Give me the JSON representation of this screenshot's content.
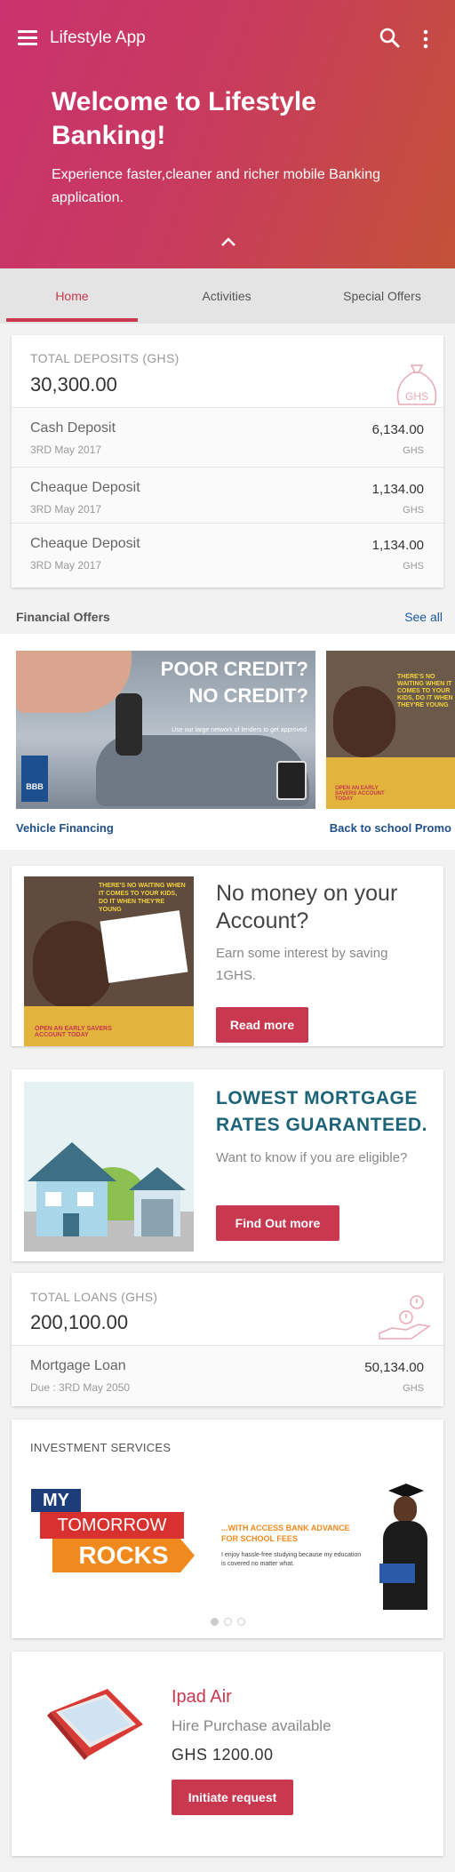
{
  "header": {
    "app_title": "Lifestyle App",
    "welcome_title": "Welcome to Lifestyle Banking!",
    "subtitle": "Experience faster,cleaner and richer mobile Banking application."
  },
  "tabs": [
    {
      "label": "Home",
      "active": true
    },
    {
      "label": "Activities",
      "active": false
    },
    {
      "label": "Special Offers",
      "active": false
    }
  ],
  "deposits": {
    "caption": "TOTAL DEPOSITS (GHS)",
    "total": "30,300.00",
    "icon_label": "GHS",
    "items": [
      {
        "name": "Cash Deposit",
        "date": "3RD May 2017",
        "amount": "6,134.00",
        "currency": "GHS"
      },
      {
        "name": "Cheaque Deposit",
        "date": "3RD May 2017",
        "amount": "1,134.00",
        "currency": "GHS"
      },
      {
        "name": "Cheaque Deposit",
        "date": "3RD May 2017",
        "amount": "1,134.00",
        "currency": "GHS"
      }
    ]
  },
  "financial_offers": {
    "title": "Financial Offers",
    "see_all": "See all",
    "items": [
      {
        "label": "Vehicle Financing",
        "headline_1": "POOR CREDIT?",
        "headline_2": "NO CREDIT?",
        "tagline": "Use our large network of lenders to get approved",
        "badge": "BBB"
      },
      {
        "label": "Back to school Promo",
        "banner": "THERE'S NO WAITING WHEN IT COMES TO YOUR KIDS, DO IT WHEN THEY'RE YOUNG",
        "footer": "OPEN AN EARLY SAVERS ACCOUNT TODAY"
      }
    ]
  },
  "savings_promo": {
    "title": "No money on your Account?",
    "text": "Earn some interest by saving 1GHS.",
    "button": "Read more",
    "image_banner": "THERE'S NO WAITING WHEN IT COMES TO YOUR KIDS, DO IT WHEN THEY'RE YOUNG",
    "image_footer": "OPEN AN EARLY SAVERS ACCOUNT TODAY"
  },
  "mortgage_promo": {
    "title": "LOWEST MORTGAGE RATES GUARANTEED.",
    "text": "Want to know if you are eligible?",
    "button": "Find Out more"
  },
  "loans": {
    "caption": "TOTAL LOANS (GHS)",
    "total": "200,100.00",
    "items": [
      {
        "name": "Mortgage Loan",
        "date": "Due : 3RD May 2050",
        "amount": "50,134.00",
        "currency": "GHS"
      }
    ]
  },
  "investment": {
    "title": "INVESTMENT SERVICES",
    "my": "MY",
    "tomorrow": "TOMORROW",
    "rocks": "ROCKS",
    "headline": "...WITH ACCESS BANK ADVANCE FOR SCHOOL FEES",
    "body": "I enjoy hassle-free studying because my education is covered no matter what.",
    "page_count": 3,
    "active_page": 1
  },
  "hire_purchase": {
    "title": "Ipad Air",
    "subtitle": "Hire Purchase available",
    "price": "GHS 1200.00",
    "button": "Initiate request"
  },
  "colors": {
    "brand_red": "#c8384e",
    "link_blue": "#1f5aa0",
    "teal": "#1d6478"
  }
}
